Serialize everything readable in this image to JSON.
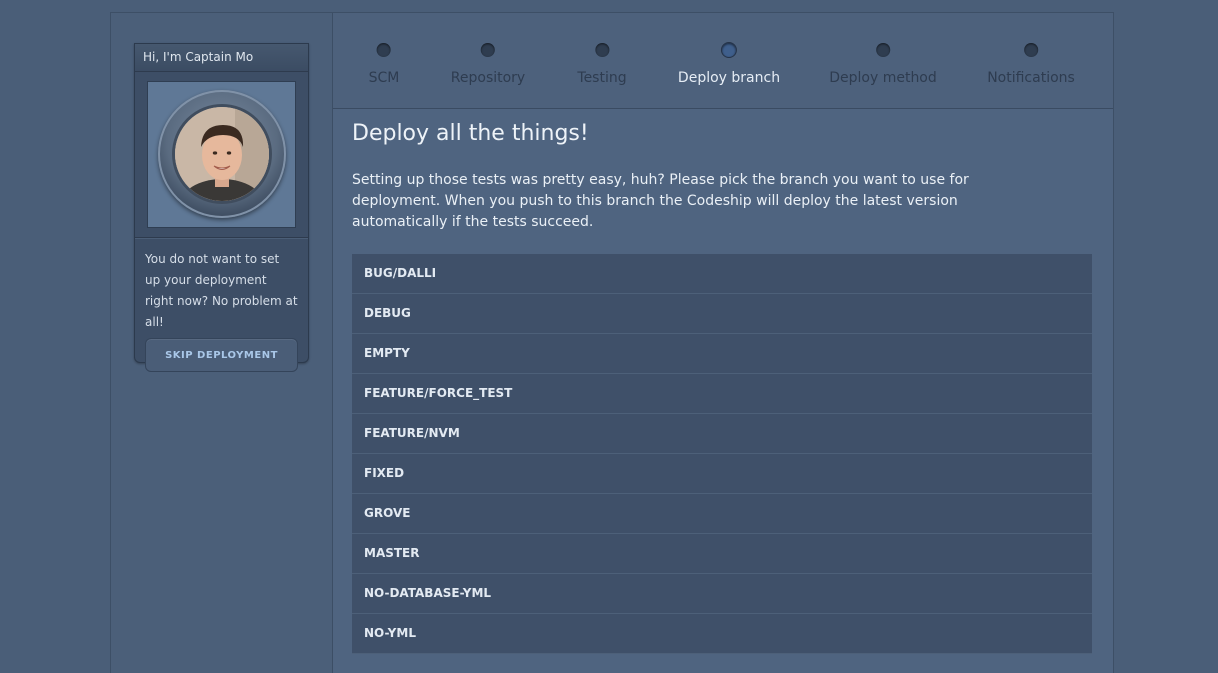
{
  "sidebar": {
    "greeting": "Hi, I'm Captain Mo",
    "message": "You do not want to set up your deployment right now? No problem at all!",
    "skip_label": "SKIP DEPLOYMENT"
  },
  "steps": [
    {
      "label": "SCM",
      "active": false
    },
    {
      "label": "Repository",
      "active": false
    },
    {
      "label": "Testing",
      "active": false
    },
    {
      "label": "Deploy branch",
      "active": true
    },
    {
      "label": "Deploy method",
      "active": false
    },
    {
      "label": "Notifications",
      "active": false
    }
  ],
  "main": {
    "title": "Deploy all the things!",
    "description": "Setting up those tests was pretty easy, huh? Please pick the branch you want to use for deployment. When you push to this branch the Codeship will deploy the latest version automatically if the tests succeed."
  },
  "branches": [
    "BUG/DALLI",
    "DEBUG",
    "EMPTY",
    "FEATURE/FORCE_TEST",
    "FEATURE/NVM",
    "FIXED",
    "GROVE",
    "MASTER",
    "NO-DATABASE-YML",
    "NO-YML"
  ]
}
